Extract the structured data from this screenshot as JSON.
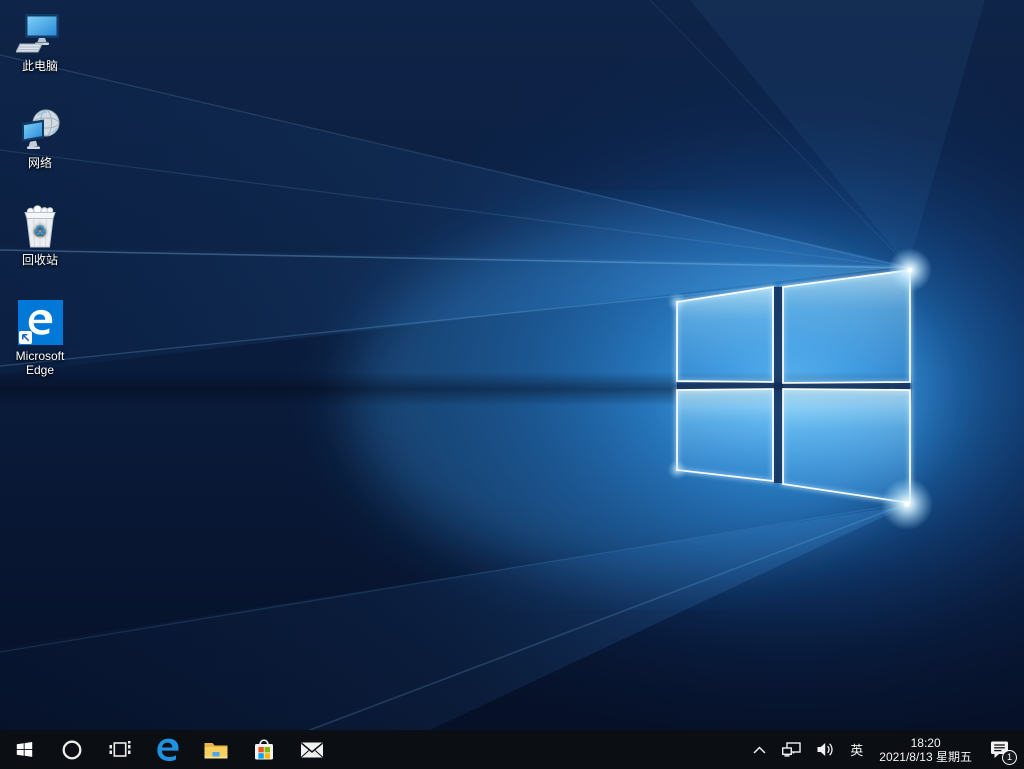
{
  "desktop": {
    "icons": [
      {
        "id": "this-pc",
        "label": "此电脑",
        "icon": "computer-monitor-keyboard-icon"
      },
      {
        "id": "network",
        "label": "网络",
        "icon": "globe-monitor-icon"
      },
      {
        "id": "recycle-bin",
        "label": "回收站",
        "icon": "recycle-bin-icon"
      },
      {
        "id": "microsoft-edge",
        "label": "Microsoft Edge",
        "label_line1": "Microsoft",
        "label_line2": "Edge",
        "icon": "edge-e-icon"
      }
    ]
  },
  "taskbar": {
    "buttons": [
      {
        "id": "start",
        "icon": "windows-logo-icon"
      },
      {
        "id": "cortana-search",
        "icon": "cortana-ring-icon"
      },
      {
        "id": "task-view",
        "icon": "task-view-icon"
      },
      {
        "id": "microsoft-edge",
        "icon": "edge-e-icon"
      },
      {
        "id": "file-explorer",
        "icon": "folder-icon"
      },
      {
        "id": "microsoft-store",
        "icon": "store-bag-icon"
      },
      {
        "id": "mail",
        "icon": "mail-envelope-icon"
      }
    ],
    "tray": {
      "hidden_icons_icon": "chevron-up-icon",
      "network_icon": "ethernet-network-icon",
      "volume_icon": "speaker-volume-icon",
      "language_indicator": "英",
      "clock": {
        "time": "18:20",
        "date": "2021/8/13 星期五"
      },
      "action_center": {
        "icon": "notification-bubble-icon",
        "badge_count": "1"
      }
    }
  },
  "wallpaper": {
    "name": "windows-10-hero-logo"
  },
  "colors": {
    "taskbar_background": "#0b0e13",
    "edge_tile_blue": "#0078d7",
    "wallpaper_dark_navy": "#081a3c",
    "wallpaper_bright_blue": "#46aef2",
    "store_red": "#f25022",
    "store_green": "#7fba00",
    "store_blue": "#00a4ef",
    "store_yellow": "#ffb900"
  }
}
